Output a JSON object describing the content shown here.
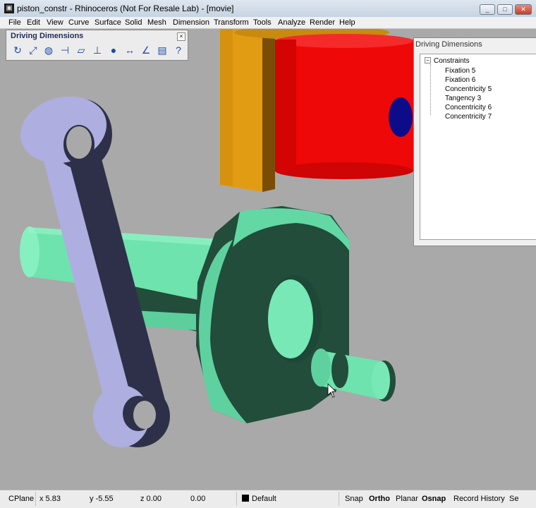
{
  "window": {
    "title": "piston_constr - Rhinoceros (Not For Resale Lab) - [movie]",
    "controls": [
      "_",
      "□",
      "✕"
    ]
  },
  "menu": [
    "File",
    "Edit",
    "View",
    "Curve",
    "Surface",
    "Solid",
    "Mesh",
    "Dimension",
    "Transform",
    "Tools",
    "Analyze",
    "Render",
    "Help"
  ],
  "toolbar": {
    "title": "Driving Dimensions",
    "close": "×",
    "tools": [
      {
        "name": "refresh-icon",
        "glyph": "↻"
      },
      {
        "name": "dimension-edit-icon",
        "glyph": "⤢"
      },
      {
        "name": "globe-icon",
        "glyph": "◍"
      },
      {
        "name": "fixation-icon",
        "glyph": "⊣"
      },
      {
        "name": "plane-icon",
        "glyph": "▱"
      },
      {
        "name": "perpendicular-icon",
        "glyph": "⊥"
      },
      {
        "name": "sphere-icon",
        "glyph": "●"
      },
      {
        "name": "distance-icon",
        "glyph": "↔"
      },
      {
        "name": "angle-icon",
        "glyph": "∠"
      },
      {
        "name": "panel-icon",
        "glyph": "▤"
      },
      {
        "name": "help-icon",
        "glyph": "?"
      }
    ]
  },
  "panel": {
    "title": "Driving Dimensions",
    "root": "Constraints",
    "expander": "−",
    "items": [
      "Fixation 5",
      "Fixation 6",
      "Concentricity 5",
      "Tangency 3",
      "Concentricity 6",
      "Concentricity 7"
    ]
  },
  "status": {
    "cplane": "CPlane",
    "x": "x 5.83",
    "y": "y -5.55",
    "z": "z 0.00",
    "d": "0.00",
    "layer": "Default",
    "snap": "Snap",
    "ortho": "Ortho",
    "planar": "Planar",
    "osnap": "Osnap",
    "history": "Record History",
    "more": "Se"
  },
  "colors": {
    "rod": "#aeaee0",
    "crank": "#6fe3b0",
    "piston": "#ef0a0a",
    "sleeve": "#e09a14",
    "pin": "#0c0c8a",
    "viewport": "#a9a9a9"
  }
}
